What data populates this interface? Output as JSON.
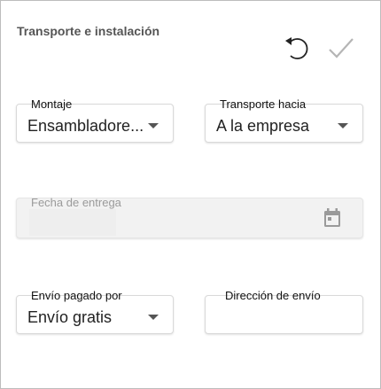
{
  "panel": {
    "title": "Transporte e instalación"
  },
  "toolbar": {
    "undo_icon": "undo-icon",
    "confirm_icon": "check-icon"
  },
  "fields": {
    "montaje": {
      "label": "Montaje",
      "value": "Ensambladore..."
    },
    "transporte": {
      "label": "Transporte hacia",
      "value": "A la empresa"
    },
    "fecha": {
      "label": "Fecha de entrega",
      "value": "",
      "icon": "calendar-icon"
    },
    "envio_pagado": {
      "label": "Envío pagado por",
      "value": "Envío gratis"
    },
    "direccion": {
      "label": "Dirección de envío",
      "value": ""
    }
  },
  "colors": {
    "border": "#d9d9d9",
    "disabled_bg": "#f2f2f2",
    "icon_dark": "#222222",
    "icon_light": "#b5b5b5"
  }
}
